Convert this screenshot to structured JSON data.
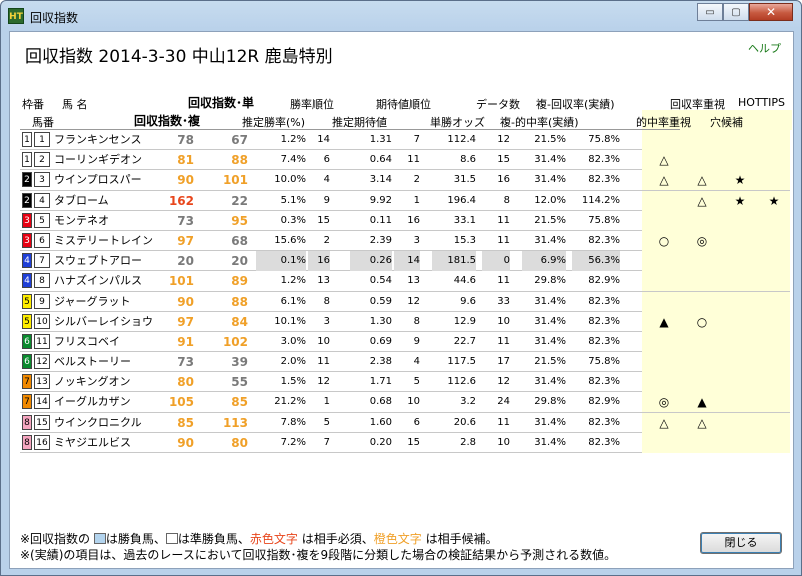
{
  "window": {
    "title": "回収指数",
    "icon": "app-icon",
    "controls": {
      "minimize": "▭",
      "maximize": "▢",
      "close": "✕"
    }
  },
  "help": "ヘルプ",
  "heading": "回収指数  2014-3-30 中山12R 鹿島特別",
  "headers": {
    "waku": "枠番",
    "uma_name": "馬  名",
    "umaban": "馬番",
    "kaishu_tan": "回収指数･単",
    "kaishu_fuku": "回収指数･複",
    "shoritsu_rank": "勝率順位",
    "kitai_rank": "期待値順位",
    "data_count": "データ数",
    "fuku_kaishu": "複-回収率(実績)",
    "suitei_shoritsu": "推定勝率(%)",
    "suitei_kitai": "推定期待値",
    "tansho_odds": "単勝オッズ",
    "fuku_tekichu": "複-的中率(実績)",
    "kaishu_juushi": "回収率重視",
    "hottips": "HOTTIPS",
    "tekichu_juushi": "的中率重視",
    "anakouho": "穴候補"
  },
  "colors": {
    "red_text": "#e8461c",
    "orange_text": "#f0a028",
    "gray_text": "#7a7a7a",
    "marks_bg": "#ffffd8"
  },
  "rows": [
    {
      "waku": "1",
      "uma": "1",
      "name": "フランキンセンス",
      "tan": "78",
      "fuku": "67",
      "tanColor": "gray",
      "fukuColor": "gray",
      "prob": "1.2%",
      "prank": "14",
      "ev": "1.31",
      "erank": "7",
      "odds": "112.4",
      "cnt": "12",
      "hit": "21.5%",
      "rec": "75.8%",
      "m1": "",
      "m2": "",
      "m3": "",
      "m4": "",
      "gray": false
    },
    {
      "waku": "1",
      "uma": "2",
      "name": "コーリンギデオン",
      "tan": "81",
      "fuku": "88",
      "tanColor": "orange",
      "fukuColor": "orange",
      "prob": "7.4%",
      "prank": "6",
      "ev": "0.64",
      "erank": "11",
      "odds": "8.6",
      "cnt": "15",
      "hit": "31.4%",
      "rec": "82.3%",
      "m1": "△",
      "m2": "",
      "m3": "",
      "m4": "",
      "gray": false
    },
    {
      "waku": "2",
      "uma": "3",
      "name": "ウインプロスパー",
      "tan": "90",
      "fuku": "101",
      "tanColor": "orange",
      "fukuColor": "orange",
      "prob": "10.0%",
      "prank": "4",
      "ev": "3.14",
      "erank": "2",
      "odds": "31.5",
      "cnt": "16",
      "hit": "31.4%",
      "rec": "82.3%",
      "m1": "△",
      "m2": "△",
      "m3": "★",
      "m4": "",
      "gray": false
    },
    {
      "waku": "2",
      "uma": "4",
      "name": "タブローム",
      "tan": "162",
      "fuku": "22",
      "tanColor": "red",
      "fukuColor": "gray",
      "prob": "5.1%",
      "prank": "9",
      "ev": "9.92",
      "erank": "1",
      "odds": "196.4",
      "cnt": "8",
      "hit": "12.0%",
      "rec": "114.2%",
      "m1": "",
      "m2": "△",
      "m3": "★",
      "m4": "★",
      "gray": false
    },
    {
      "waku": "3",
      "uma": "5",
      "name": "モンテネオ",
      "tan": "73",
      "fuku": "95",
      "tanColor": "gray",
      "fukuColor": "orange",
      "prob": "0.3%",
      "prank": "15",
      "ev": "0.11",
      "erank": "16",
      "odds": "33.1",
      "cnt": "11",
      "hit": "21.5%",
      "rec": "75.8%",
      "m1": "",
      "m2": "",
      "m3": "",
      "m4": "",
      "gray": false
    },
    {
      "waku": "3",
      "uma": "6",
      "name": "ミステリートレイン",
      "tan": "97",
      "fuku": "68",
      "tanColor": "orange",
      "fukuColor": "gray",
      "prob": "15.6%",
      "prank": "2",
      "ev": "2.39",
      "erank": "3",
      "odds": "15.3",
      "cnt": "11",
      "hit": "31.4%",
      "rec": "82.3%",
      "m1": "○",
      "m2": "◎",
      "m3": "",
      "m4": "",
      "gray": false
    },
    {
      "waku": "4",
      "uma": "7",
      "name": "スウェプトアロー",
      "tan": "20",
      "fuku": "20",
      "tanColor": "gray",
      "fukuColor": "gray",
      "prob": "0.1%",
      "prank": "16",
      "ev": "0.26",
      "erank": "14",
      "odds": "181.5",
      "cnt": "0",
      "hit": "6.9%",
      "rec": "56.3%",
      "m1": "",
      "m2": "",
      "m3": "",
      "m4": "",
      "gray": true
    },
    {
      "waku": "4",
      "uma": "8",
      "name": "ハナズインパルス",
      "tan": "101",
      "fuku": "89",
      "tanColor": "orange",
      "fukuColor": "orange",
      "prob": "1.2%",
      "prank": "13",
      "ev": "0.54",
      "erank": "13",
      "odds": "44.6",
      "cnt": "11",
      "hit": "29.8%",
      "rec": "82.9%",
      "m1": "",
      "m2": "",
      "m3": "",
      "m4": "",
      "gray": false
    },
    {
      "waku": "5",
      "uma": "9",
      "name": "ジャーグラット",
      "tan": "90",
      "fuku": "88",
      "tanColor": "orange",
      "fukuColor": "orange",
      "prob": "6.1%",
      "prank": "8",
      "ev": "0.59",
      "erank": "12",
      "odds": "9.6",
      "cnt": "33",
      "hit": "31.4%",
      "rec": "82.3%",
      "m1": "",
      "m2": "",
      "m3": "",
      "m4": "",
      "gray": false
    },
    {
      "waku": "5",
      "uma": "10",
      "name": "シルバーレイショウ",
      "tan": "97",
      "fuku": "84",
      "tanColor": "orange",
      "fukuColor": "orange",
      "prob": "10.1%",
      "prank": "3",
      "ev": "1.30",
      "erank": "8",
      "odds": "12.9",
      "cnt": "10",
      "hit": "31.4%",
      "rec": "82.3%",
      "m1": "▲",
      "m2": "○",
      "m3": "",
      "m4": "",
      "gray": false
    },
    {
      "waku": "6",
      "uma": "11",
      "name": "フリスコベイ",
      "tan": "91",
      "fuku": "102",
      "tanColor": "orange",
      "fukuColor": "orange",
      "prob": "3.0%",
      "prank": "10",
      "ev": "0.69",
      "erank": "9",
      "odds": "22.7",
      "cnt": "11",
      "hit": "31.4%",
      "rec": "82.3%",
      "m1": "",
      "m2": "",
      "m3": "",
      "m4": "",
      "gray": false
    },
    {
      "waku": "6",
      "uma": "12",
      "name": "ベルストーリー",
      "tan": "73",
      "fuku": "39",
      "tanColor": "gray",
      "fukuColor": "gray",
      "prob": "2.0%",
      "prank": "11",
      "ev": "2.38",
      "erank": "4",
      "odds": "117.5",
      "cnt": "17",
      "hit": "21.5%",
      "rec": "75.8%",
      "m1": "",
      "m2": "",
      "m3": "",
      "m4": "",
      "gray": false
    },
    {
      "waku": "7",
      "uma": "13",
      "name": "ノッキングオン",
      "tan": "80",
      "fuku": "55",
      "tanColor": "orange",
      "fukuColor": "gray",
      "prob": "1.5%",
      "prank": "12",
      "ev": "1.71",
      "erank": "5",
      "odds": "112.6",
      "cnt": "12",
      "hit": "31.4%",
      "rec": "82.3%",
      "m1": "",
      "m2": "",
      "m3": "",
      "m4": "",
      "gray": false
    },
    {
      "waku": "7",
      "uma": "14",
      "name": "イーグルカザン",
      "tan": "105",
      "fuku": "85",
      "tanColor": "orange",
      "fukuColor": "orange",
      "prob": "21.2%",
      "prank": "1",
      "ev": "0.68",
      "erank": "10",
      "odds": "3.2",
      "cnt": "24",
      "hit": "29.8%",
      "rec": "82.9%",
      "m1": "◎",
      "m2": "▲",
      "m3": "",
      "m4": "",
      "gray": false
    },
    {
      "waku": "8",
      "uma": "15",
      "name": "ウインクロニクル",
      "tan": "85",
      "fuku": "113",
      "tanColor": "orange",
      "fukuColor": "orange",
      "prob": "7.8%",
      "prank": "5",
      "ev": "1.60",
      "erank": "6",
      "odds": "20.6",
      "cnt": "11",
      "hit": "31.4%",
      "rec": "82.3%",
      "m1": "△",
      "m2": "△",
      "m3": "",
      "m4": "",
      "gray": false
    },
    {
      "waku": "8",
      "uma": "16",
      "name": "ミヤジエルビス",
      "tan": "90",
      "fuku": "80",
      "tanColor": "orange",
      "fukuColor": "orange",
      "prob": "7.2%",
      "prank": "7",
      "ev": "0.20",
      "erank": "15",
      "odds": "2.8",
      "cnt": "10",
      "hit": "31.4%",
      "rec": "82.3%",
      "m1": "",
      "m2": "",
      "m3": "",
      "m4": "",
      "gray": false
    }
  ],
  "waku_colors": {
    "1": {
      "bg": "#ffffff",
      "fg": "#000"
    },
    "2": {
      "bg": "#000000",
      "fg": "#fff"
    },
    "3": {
      "bg": "#e60012",
      "fg": "#fff"
    },
    "4": {
      "bg": "#1f3fd6",
      "fg": "#fff"
    },
    "5": {
      "bg": "#ffee00",
      "fg": "#000"
    },
    "6": {
      "bg": "#0a8a2e",
      "fg": "#fff"
    },
    "7": {
      "bg": "#f28a00",
      "fg": "#000"
    },
    "8": {
      "bg": "#f6a6c0",
      "fg": "#000"
    }
  },
  "notes": {
    "n1_prefix": "※回収指数の ",
    "n1_a": "は勝負馬、",
    "n1_b": "は準勝負馬、",
    "n1_red": "赤色文字",
    "n1_c": " は相手必須、",
    "n1_orange": "橙色文字",
    "n1_d": " は相手候補。",
    "n2": "※(実績)の項目は、過去のレースにおいて回収指数･複を9段階に分類した場合の検証結果から予測される数値。"
  },
  "close_button": "閉じる"
}
